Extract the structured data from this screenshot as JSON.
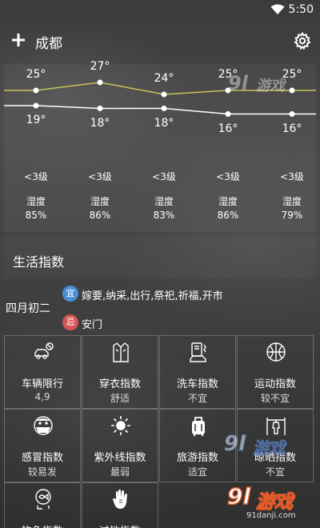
{
  "status_bar": {
    "time": "5:50"
  },
  "app_bar": {
    "city": "成都"
  },
  "forecast": {
    "days": [
      {
        "high": "25°",
        "low": "19°",
        "wind": "<3级",
        "humidity_label": "湿度",
        "humidity": "85%"
      },
      {
        "high": "27°",
        "low": "18°",
        "wind": "<3级",
        "humidity_label": "湿度",
        "humidity": "86%"
      },
      {
        "high": "24°",
        "low": "18°",
        "wind": "<3级",
        "humidity_label": "湿度",
        "humidity": "83%"
      },
      {
        "high": "25°",
        "low": "16°",
        "wind": "<3级",
        "humidity_label": "湿度",
        "humidity": "86%"
      },
      {
        "high": "25°",
        "low": "16°",
        "wind": "<3级",
        "humidity_label": "湿度",
        "humidity": "79%"
      }
    ]
  },
  "chart_data": {
    "type": "line",
    "x": [
      1,
      2,
      3,
      4,
      5
    ],
    "series": [
      {
        "values": [
          25,
          27,
          24,
          25,
          25
        ],
        "color": "#c9c25a"
      },
      {
        "values": [
          19,
          18,
          18,
          16,
          16
        ],
        "color": "#ffffff"
      }
    ]
  },
  "life_index": {
    "title": "生活指数"
  },
  "almanac": {
    "lunar_date": "四月初二",
    "good_badge": "宜",
    "good_text": "嫁要,纳采,出行,祭祀,祈福,开市",
    "bad_badge": "忌",
    "bad_text": "安门"
  },
  "indices": [
    {
      "icon": "car-icon",
      "label": "车辆限行",
      "value": "4,9"
    },
    {
      "icon": "clothing-icon",
      "label": "穿衣指数",
      "value": "舒适"
    },
    {
      "icon": "car-wash-icon",
      "label": "洗车指数",
      "value": "不宜"
    },
    {
      "icon": "basketball-icon",
      "label": "运动指数",
      "value": "较不宜"
    },
    {
      "icon": "cold-mask-icon",
      "label": "感冒指数",
      "value": "较易发"
    },
    {
      "icon": "sun-icon",
      "label": "紫外线指数",
      "value": "最弱"
    },
    {
      "icon": "luggage-icon",
      "label": "旅游指数",
      "value": "适宜"
    },
    {
      "icon": "drying-rack-icon",
      "label": "晾晒指数",
      "value": "不宜"
    },
    {
      "icon": "fishing-icon",
      "label": "钓鱼指数",
      "value": ""
    },
    {
      "icon": "hand-icon",
      "label": "过敏指数",
      "value": ""
    }
  ],
  "watermark": {
    "brand": "9l游戏",
    "domain": "91danji.com"
  }
}
